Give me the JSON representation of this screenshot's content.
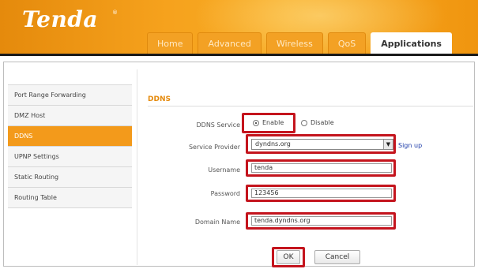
{
  "brand": {
    "logo": "Tenda",
    "logo_mark": "®"
  },
  "tabs": [
    {
      "label": "Home"
    },
    {
      "label": "Advanced"
    },
    {
      "label": "Wireless"
    },
    {
      "label": "QoS"
    },
    {
      "label": "Applications"
    }
  ],
  "sidebar": {
    "items": [
      {
        "label": "Port Range Forwarding"
      },
      {
        "label": "DMZ Host"
      },
      {
        "label": "DDNS"
      },
      {
        "label": "UPNP Settings"
      },
      {
        "label": "Static Routing"
      },
      {
        "label": "Routing Table"
      }
    ]
  },
  "section": {
    "title": "DDNS"
  },
  "form": {
    "service_label": "DDNS Service",
    "enable_label": "Enable",
    "disable_label": "Disable",
    "provider_label": "Service Provider",
    "provider_value": "dyndns.org",
    "signup_link": "Sign up",
    "username_label": "Username",
    "username_value": "tenda",
    "password_label": "Password",
    "password_value": "123456",
    "domain_label": "Domain Name",
    "domain_value": "tenda.dyndns.org"
  },
  "buttons": {
    "ok": "OK",
    "cancel": "Cancel"
  },
  "colors": {
    "brand_orange": "#f39a1b",
    "highlight_red": "#c4141d",
    "link_blue": "#1b3aa8"
  }
}
